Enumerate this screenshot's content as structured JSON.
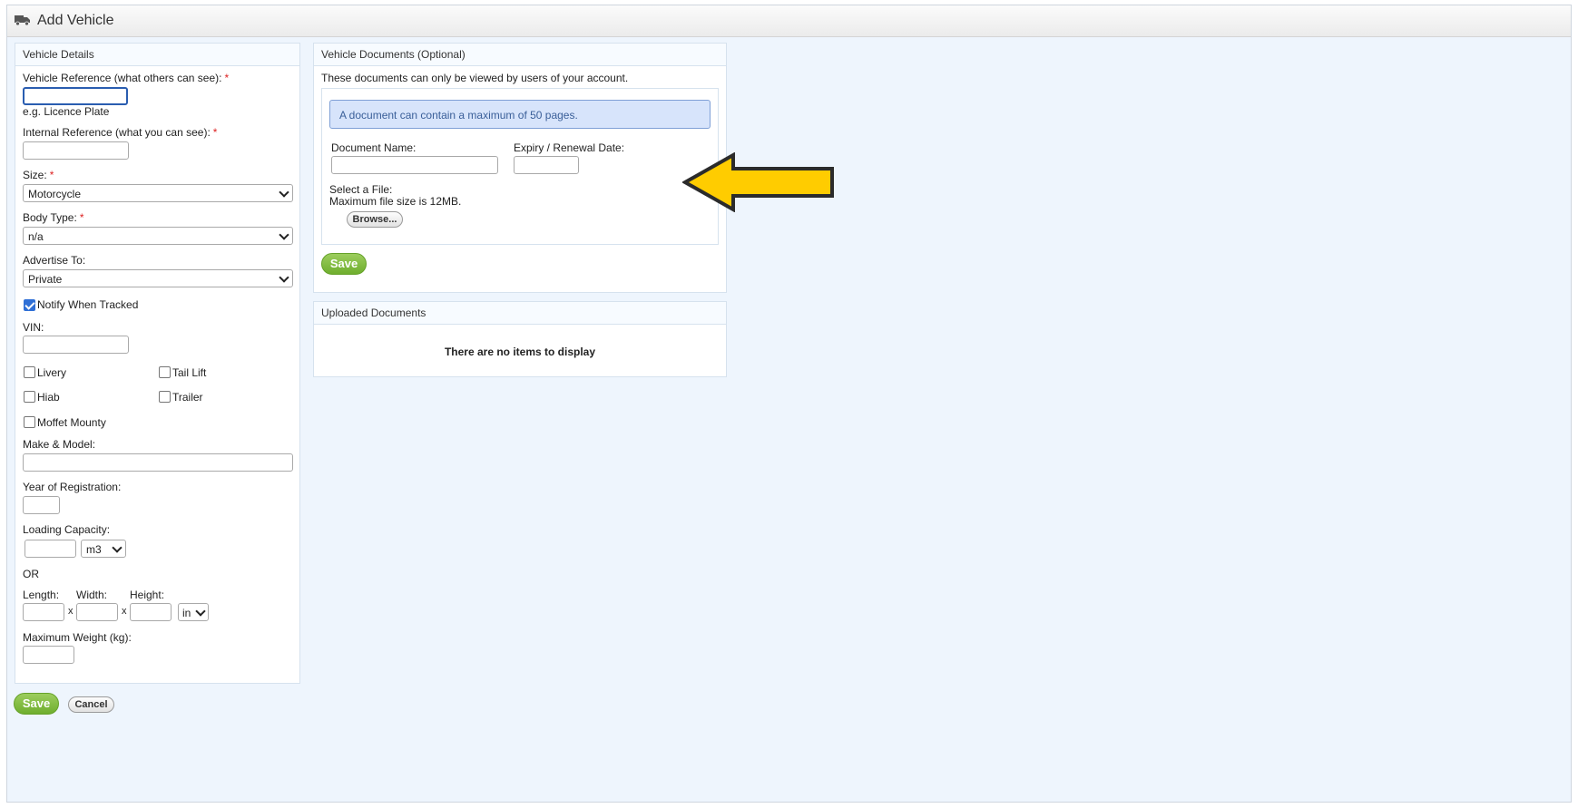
{
  "window": {
    "title": "Add Vehicle",
    "icon": "truck-icon"
  },
  "vehicle_details": {
    "heading": "Vehicle Details",
    "vehicle_reference": {
      "label": "Vehicle Reference (what others can see):",
      "required": "*",
      "value": "",
      "hint": "e.g. Licence Plate"
    },
    "internal_reference": {
      "label": "Internal Reference (what you can see):",
      "required": "*",
      "value": ""
    },
    "size": {
      "label": "Size:",
      "required": "*",
      "selected": "Motorcycle"
    },
    "body_type": {
      "label": "Body Type:",
      "required": "*",
      "selected": "n/a"
    },
    "advertise_to": {
      "label": "Advertise To:",
      "selected": "Private"
    },
    "notify_when_tracked": {
      "label": "Notify When Tracked",
      "checked": true
    },
    "vin": {
      "label": "VIN:",
      "value": ""
    },
    "options": [
      {
        "label": "Livery",
        "checked": false
      },
      {
        "label": "Tail Lift",
        "checked": false
      },
      {
        "label": "Hiab",
        "checked": false
      },
      {
        "label": "Trailer",
        "checked": false
      },
      {
        "label": "Moffet Mounty",
        "checked": false
      }
    ],
    "make_model": {
      "label": "Make & Model:",
      "value": ""
    },
    "year_registration": {
      "label": "Year of Registration:",
      "value": ""
    },
    "loading_capacity": {
      "label": "Loading Capacity:",
      "value": "",
      "unit": "m3"
    },
    "or_label": "OR",
    "dimensions": {
      "length_label": "Length:",
      "width_label": "Width:",
      "height_label": "Height:",
      "separator": "x",
      "unit": "in"
    },
    "max_weight": {
      "label": "Maximum Weight (kg):",
      "value": ""
    }
  },
  "vehicle_documents": {
    "heading": "Vehicle Documents (Optional)",
    "note": "These documents can only be viewed by users of your account.",
    "info": "A document can contain a maximum of 50 pages.",
    "document_name_label": "Document Name:",
    "expiry_label": "Expiry / Renewal Date:",
    "select_file_label": "Select a File:",
    "max_file_size": "Maximum file size is 12MB.",
    "browse_label": "Browse...",
    "save_label": "Save"
  },
  "uploaded_documents": {
    "heading": "Uploaded Documents",
    "empty": "There are no items to display"
  },
  "footer": {
    "save_label": "Save",
    "cancel_label": "Cancel"
  },
  "annotation": {
    "arrow_color": "#FFCC00",
    "arrow_outline": "#2b2b2b"
  }
}
